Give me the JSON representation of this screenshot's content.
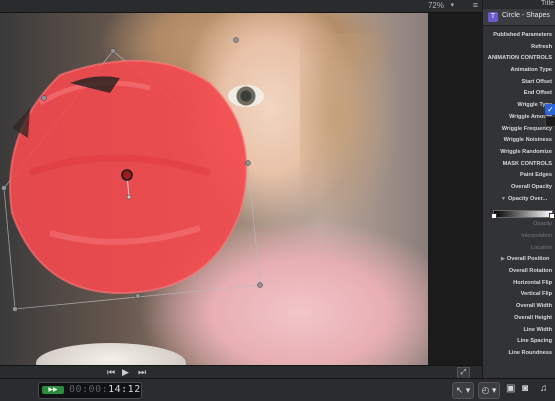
{
  "viewer": {
    "zoom": "72%",
    "zoom_caret": "▾",
    "view_menu": "≡"
  },
  "inspector": {
    "tab_label": "Title",
    "title": "Circle - Shapes",
    "gen_icon": "T",
    "rows": [
      {
        "label": "Published Parameters",
        "kind": "header"
      },
      {
        "label": "Refresh",
        "kind": "param"
      },
      {
        "label": "ANIMATION CONTROLS",
        "kind": "header"
      },
      {
        "label": "Animation Type",
        "kind": "param"
      },
      {
        "label": "Start Offset",
        "kind": "param"
      },
      {
        "label": "End Offset",
        "kind": "param"
      },
      {
        "label": "Wriggle Type",
        "kind": "param"
      },
      {
        "label": "Wriggle Amount",
        "kind": "param"
      },
      {
        "label": "Wriggle Frequency",
        "kind": "param"
      },
      {
        "label": "Wriggle Noisiness",
        "kind": "param"
      },
      {
        "label": "Wriggle Randomize",
        "kind": "param"
      },
      {
        "label": "MASK CONTROLS",
        "kind": "header"
      },
      {
        "label": "Paint Edges",
        "kind": "param"
      },
      {
        "label": "Overall Opacity",
        "kind": "param"
      },
      {
        "label": "Opacity Over...",
        "kind": "expandable"
      },
      {
        "label": "",
        "kind": "gradient"
      },
      {
        "label": "Opacity",
        "kind": "dim"
      },
      {
        "label": "Interpolation",
        "kind": "dim"
      },
      {
        "label": "Location",
        "kind": "dim"
      },
      {
        "label": "Overall Position",
        "kind": "expandable"
      },
      {
        "label": "Overall Rotation",
        "kind": "param"
      },
      {
        "label": "Horizontal Flip",
        "kind": "param"
      },
      {
        "label": "Vertical Flip",
        "kind": "param"
      },
      {
        "label": "Overall Width",
        "kind": "param"
      },
      {
        "label": "Overall Height",
        "kind": "param"
      },
      {
        "label": "Line Width",
        "kind": "param"
      },
      {
        "label": "Line Spacing",
        "kind": "param"
      },
      {
        "label": "Line Roundness",
        "kind": "param"
      }
    ],
    "popup_check": "✓"
  },
  "transport": {
    "prev": "⏮",
    "play": "▶",
    "next": "⏭",
    "fullscreen": "⤢"
  },
  "timecode": {
    "icon": "▶▶",
    "dim": "00:00:",
    "value": "14:12"
  },
  "toolbar": {
    "select_tool": "↖ ▾",
    "retime": "◴ ▾",
    "photos": "▣",
    "camera": "◙",
    "music": "♫"
  },
  "colors": {
    "mask_red": "#f24a4e",
    "accent_blue": "#2d63d6",
    "timecode_green": "#2b8c3f"
  }
}
